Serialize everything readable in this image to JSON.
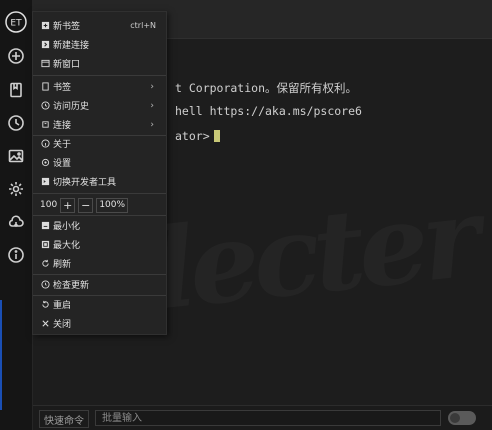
{
  "terminal": {
    "line1": "t Corporation。保留所有权利。",
    "line2": "hell https://aka.ms/pscore6",
    "line3": "ator>",
    "watermark": "lecter"
  },
  "rail": {
    "icons": [
      "logo-icon",
      "add-icon",
      "bookmark-icon",
      "history-icon",
      "image-icon",
      "settings-icon",
      "cloud-sync-icon",
      "info-icon"
    ]
  },
  "menu": {
    "items": [
      {
        "label": "新书签",
        "shortcut": "ctrl+N",
        "icon": "new-bookmark-icon"
      },
      {
        "label": "新建连接",
        "icon": "new-connection-icon"
      },
      {
        "label": "新窗口",
        "icon": "new-window-icon"
      },
      {
        "label": "书签",
        "icon": "bookmark-icon"
      },
      {
        "label": "访问历史",
        "icon": "history-icon"
      },
      {
        "label": "连接",
        "icon": "connection-icon"
      },
      {
        "label": "关于",
        "icon": "about-icon"
      },
      {
        "label": "设置",
        "icon": "settings-icon"
      },
      {
        "label": "切换开发者工具",
        "icon": "devtools-icon"
      },
      {
        "label": "最小化",
        "icon": "minimize-icon"
      },
      {
        "label": "最大化",
        "icon": "maximize-icon"
      },
      {
        "label": "刷新",
        "icon": "refresh-icon"
      },
      {
        "label": "检查更新",
        "icon": "check-update-icon"
      },
      {
        "label": "重启",
        "icon": "restart-icon"
      },
      {
        "label": "关闭",
        "icon": "close-icon"
      }
    ],
    "zoom": {
      "value": "100",
      "plus": "+",
      "minus": "−",
      "reset": "100%"
    },
    "submenu_arrow": "›"
  },
  "bottom": {
    "quick_command": "快速命令",
    "batch_placeholder": "批量输入"
  }
}
